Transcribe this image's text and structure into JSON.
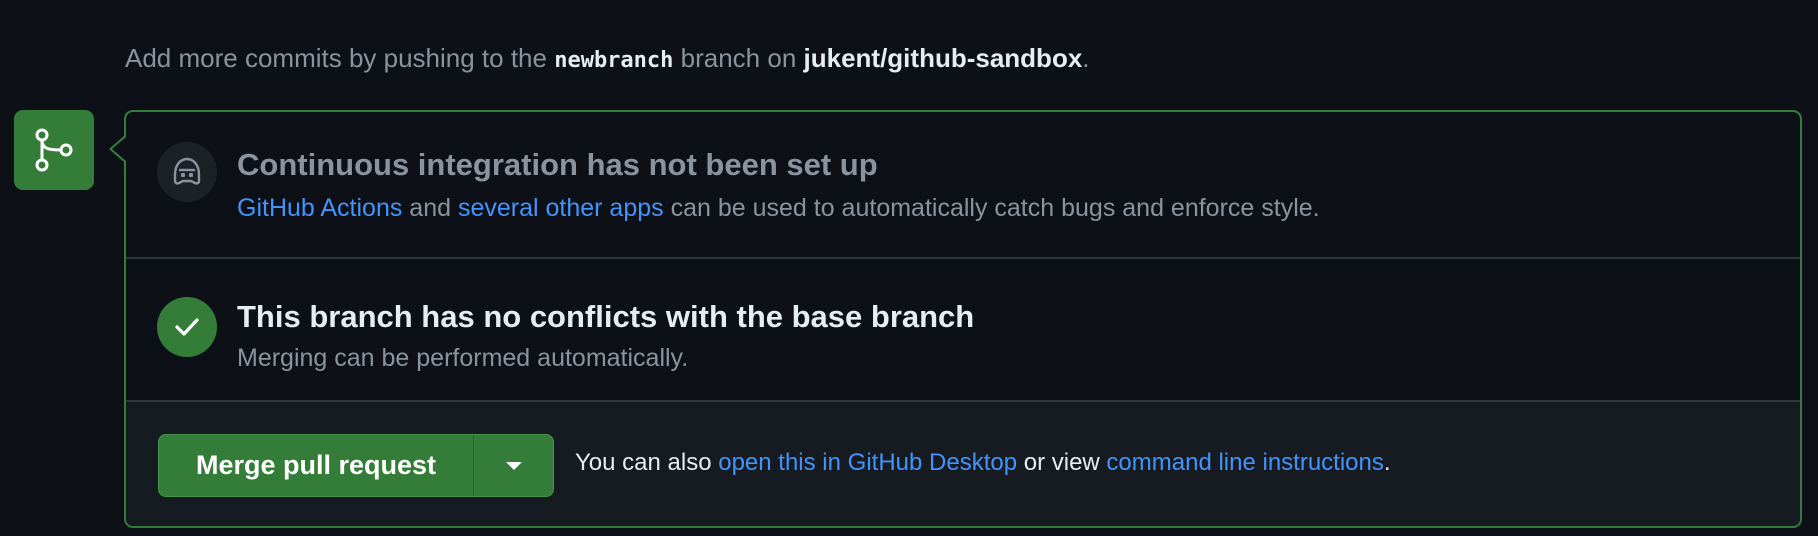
{
  "hint": {
    "prefix": "Add more commits by pushing to the ",
    "branch": "newbranch",
    "middle": " branch on ",
    "repo": "jukent/github-sandbox",
    "suffix": "."
  },
  "ci": {
    "title": "Continuous integration has not been set up",
    "link1": "GitHub Actions",
    "and": " and ",
    "link2": "several other apps",
    "rest": " can be used to automatically catch bugs and enforce style."
  },
  "conflicts": {
    "title": "This branch has no conflicts with the base branch",
    "desc": "Merging can be performed automatically."
  },
  "merge": {
    "button_label": "Merge pull request",
    "note_prefix": "You can also ",
    "desktop_link": "open this in GitHub Desktop",
    "note_middle": " or view ",
    "cli_link": "command line instructions",
    "note_suffix": "."
  },
  "icons": {
    "merge_box": "git-merge-icon",
    "ci": "copilot-robot-icon",
    "conflicts": "check-icon",
    "dropdown": "triangle-down-icon"
  },
  "colors": {
    "background": "#0d1117",
    "success_green": "#347d39",
    "link_blue": "#4493f8",
    "muted_text": "#8b949e",
    "border": "#30363d"
  }
}
